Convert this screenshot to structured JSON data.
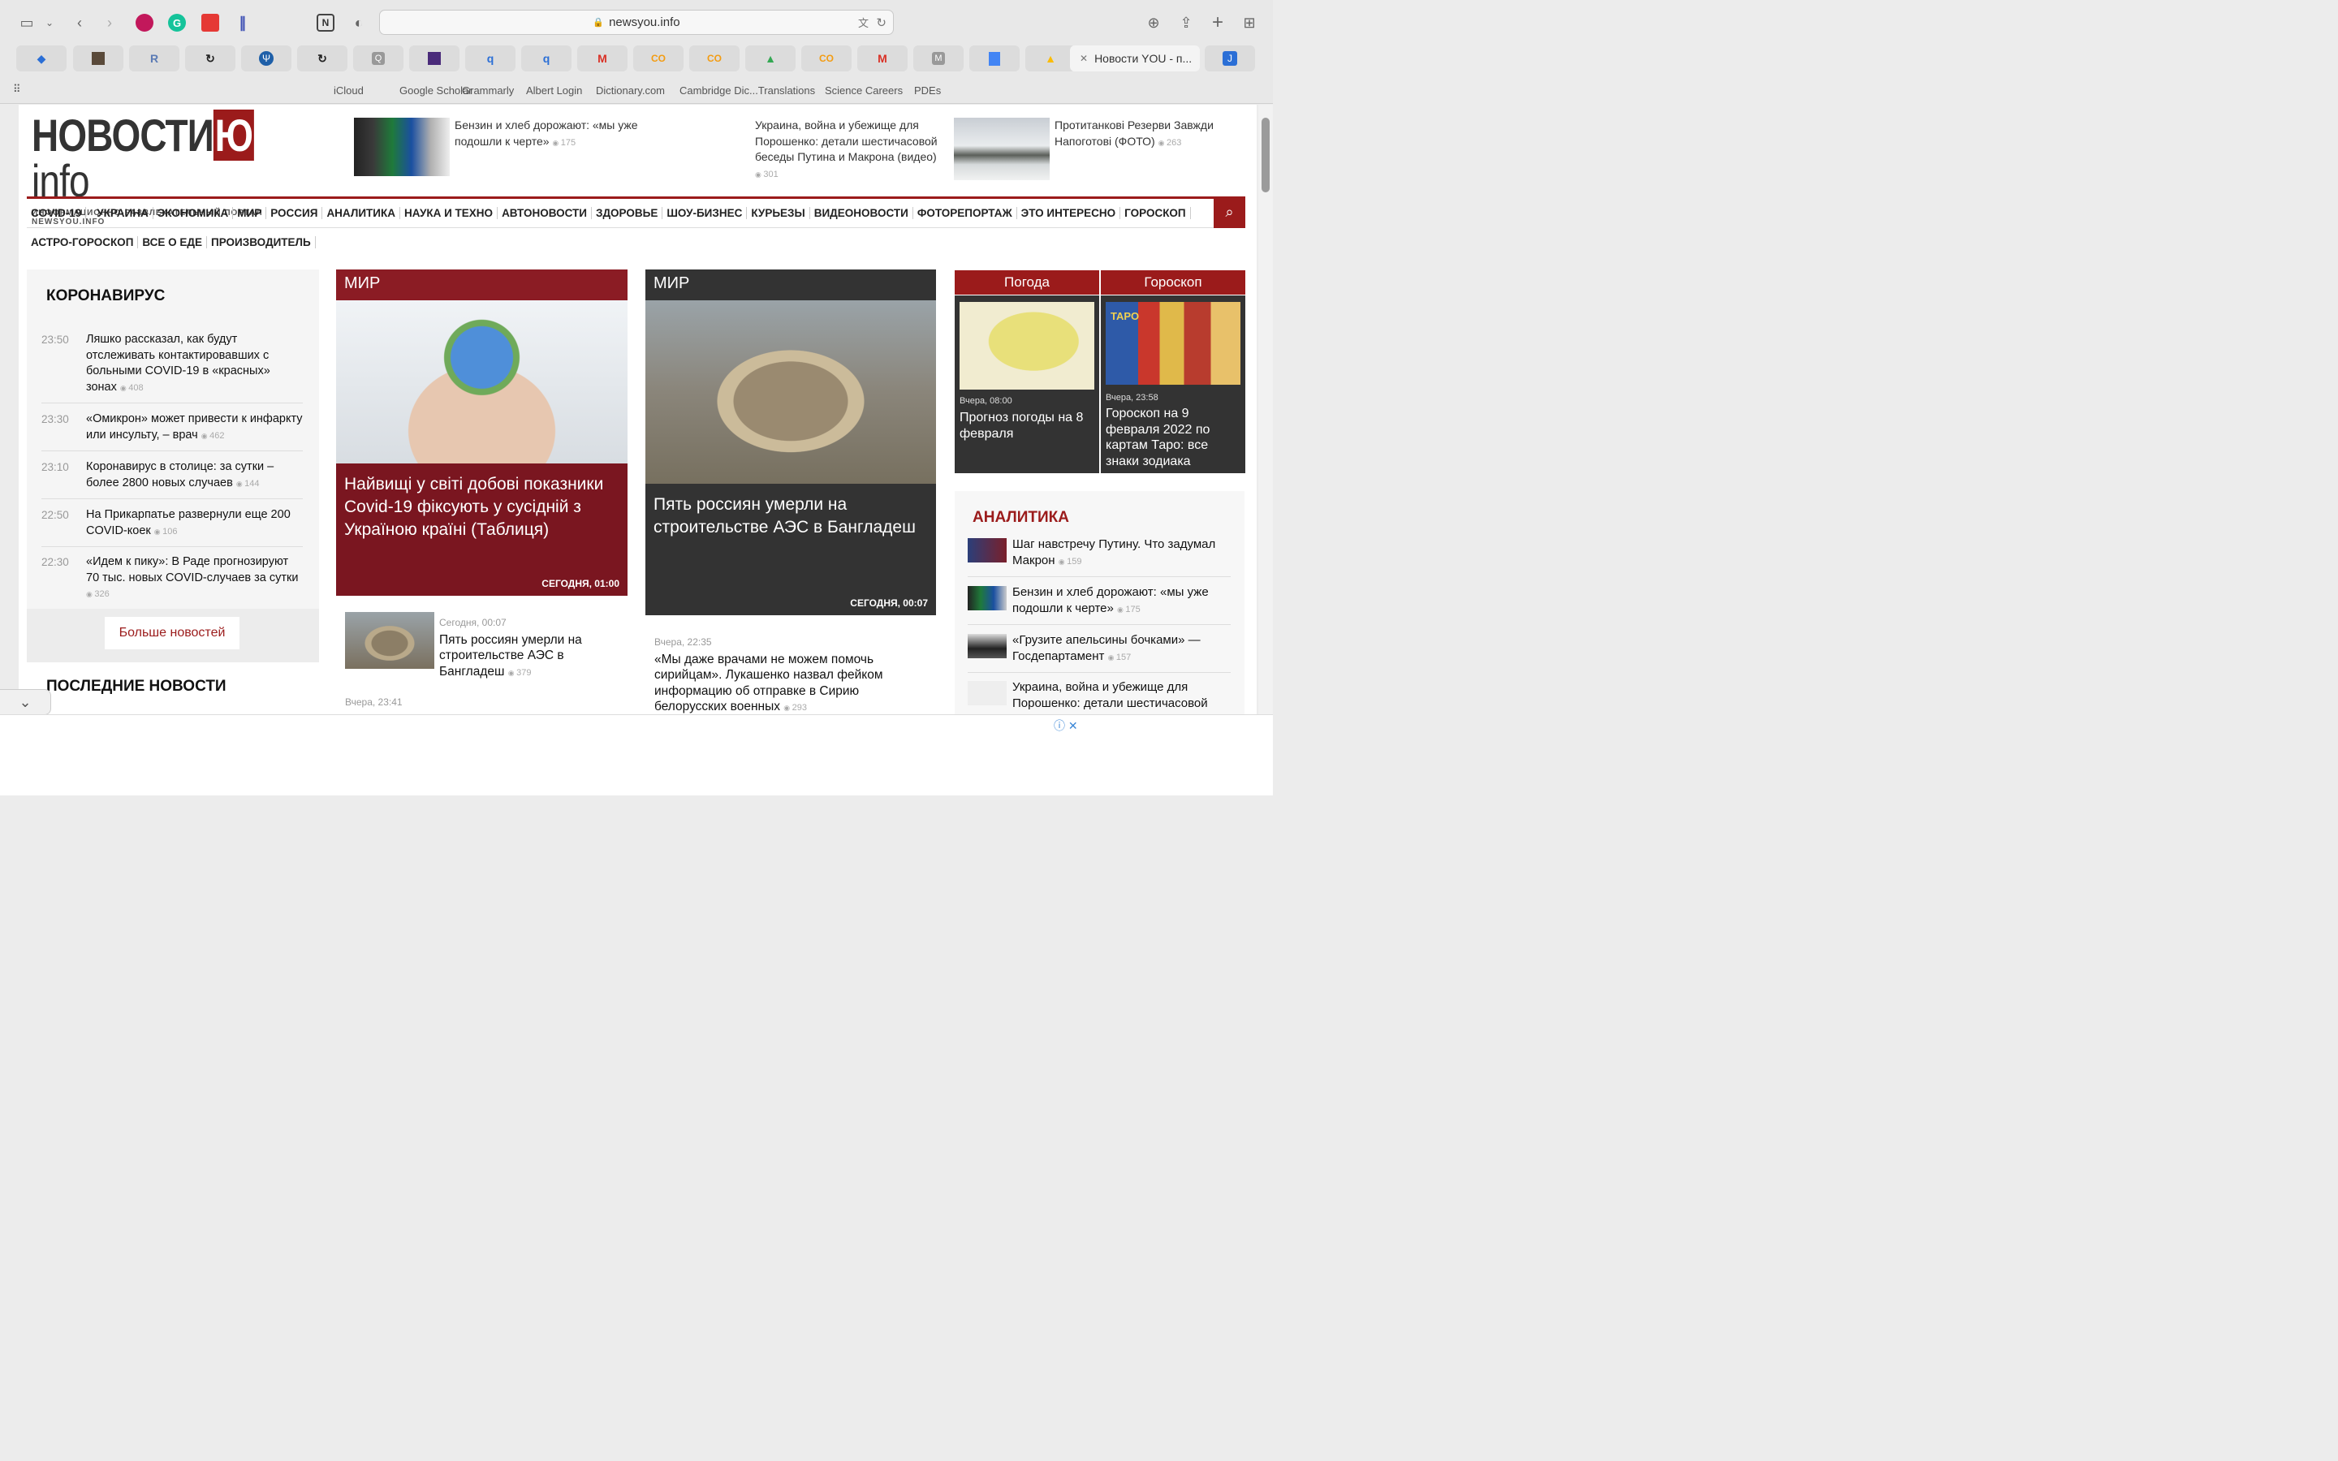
{
  "browser": {
    "url": "newsyou.info",
    "active_tab": "Новости YOU - п...",
    "tab_icons": [
      "layers-icon",
      "photo-icon",
      "r-icon",
      "loop-icon",
      "psi-icon",
      "loop-icon",
      "q-icon",
      "tarot-icon",
      "q-icon",
      "q-icon",
      "gmail-icon",
      "cc-icon",
      "cc-icon",
      "drive-icon",
      "cc-icon",
      "gmail-icon",
      "m-icon",
      "docs-icon",
      "drive-icon"
    ],
    "favorites": [
      "iCloud",
      "Google Scholar",
      "Grammarly",
      "Albert Login",
      "Dictionary.com",
      "Cambridge Dic...Translations",
      "Science Careers",
      "PDEs"
    ]
  },
  "site": {
    "logo_main": "НОВОСТИ",
    "logo_red": "Ю",
    "logo_info": "info",
    "logo_sub": "ИНФОРМАЦИОННО-РАЗВЛЕКАТЕЛЬНЫЙ ПОРТАЛ NEWSYOU.INFO"
  },
  "top_news": [
    {
      "title": "Бензин и хлеб дорожают: «мы уже подошли к черте»",
      "views": "175"
    },
    {
      "title": "Украина, война и убежище для Порошенко: детали шестичасовой беседы Путина и Макрона (видео)",
      "views": "301"
    },
    {
      "title": "Протитанкові Резерви Завжди Напоготові (ФОТО)",
      "views": "263"
    }
  ],
  "nav": [
    "COVID-19",
    "УКРАИНА",
    "ЭКОНОМИКА",
    "МИР",
    "РОССИЯ",
    "АНАЛИТИКА",
    "НАУКА И ТЕХНО",
    "АВТОНОВОСТИ",
    "ЗДОРОВЬЕ",
    "ШОУ-БИЗНЕС",
    "КУРЬЕЗЫ",
    "ВИДЕОНОВОСТИ",
    "ФОТОРЕПОРТАЖ",
    "ЭТО ИНТЕРЕСНО",
    "ГОРОСКОП"
  ],
  "nav2": [
    "АСТРО-ГОРОСКОП",
    "ВСЕ О ЕДЕ",
    "ПРОИЗВОДИТЕЛЬ"
  ],
  "corona": {
    "title": "КОРОНАВИРУС",
    "items": [
      {
        "time": "23:50",
        "title": "Ляшко рассказал, как будут отслеживать контактировавших с больными COVID-19 в «красных» зонах",
        "views": "408"
      },
      {
        "time": "23:30",
        "title": "«Омикрон» может привести к инфаркту или инсульту, – врач",
        "views": "462"
      },
      {
        "time": "23:10",
        "title": "Коронавирус в столице: за сутки – более 2800 новых случаев",
        "views": "144"
      },
      {
        "time": "22:50",
        "title": "На Прикарпатье развернули еще 200 COVID-коек",
        "views": "106"
      },
      {
        "time": "22:30",
        "title": "«Идем к пику»: В Раде прогнозируют 70 тыс. новых COVID-случаев за сутки",
        "views": "326"
      }
    ],
    "more": "Больше новостей",
    "last_title": "ПОСЛЕДНИЕ НОВОСТИ"
  },
  "card1": {
    "section": "МИР",
    "title": "Найвищі у світі добові показники Covid-19 фіксують у сусідній з Україною країні (Таблиця)",
    "date": "СЕГОДНЯ, 01:00"
  },
  "card2": {
    "section": "МИР",
    "title": "Пять россиян умерли на строительстве АЭС в Бангладеш",
    "date": "СЕГОДНЯ, 00:07"
  },
  "small1": {
    "date": "Сегодня, 00:07",
    "title": "Пять россиян умерли на строительстве АЭС в Бангладеш",
    "views": "379"
  },
  "small2": {
    "date": "Вчера, 23:41"
  },
  "small3": {
    "date": "Вчера, 22:35",
    "title": "«Мы даже врачами не можем помочь сирийцам». Лукашенко назвал фейком информацию об отправке в Сирию белорусских военных",
    "views": "293"
  },
  "weather": {
    "tab": "Погода",
    "date": "Вчера, 08:00",
    "title": "Прогноз погоды на 8 февраля"
  },
  "horoscope": {
    "tab": "Гороскоп",
    "date": "Вчера, 23:58",
    "title": "Гороскоп на 9 февраля 2022 по картам Таро: все знаки зодиака",
    "card_text": "TAPO"
  },
  "analytics": {
    "title": "АНАЛИТИКА",
    "items": [
      {
        "title": "Шаг навстречу Путину. Что задумал Макрон",
        "views": "159"
      },
      {
        "title": "Бензин и хлеб дорожают: «мы уже подошли к черте»",
        "views": "175"
      },
      {
        "title": "«Грузите апельсины бочками» — Госдепартамент",
        "views": "157"
      },
      {
        "title": "Украина, война и убежище для Порошенко: детали шестичасовой"
      }
    ]
  }
}
